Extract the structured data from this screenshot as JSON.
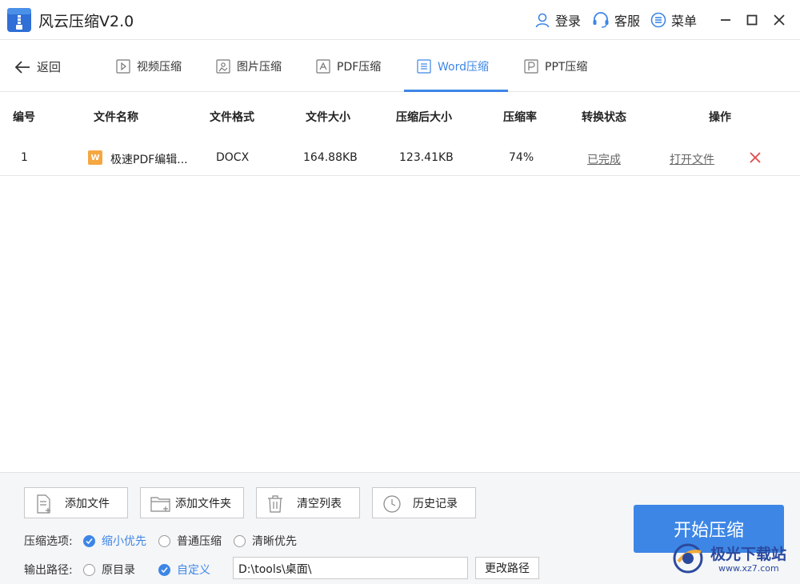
{
  "app": {
    "title": "风云压缩V2.0",
    "accent_color": "#3d86e6"
  },
  "header_actions": {
    "login": "登录",
    "service": "客服",
    "menu": "菜单"
  },
  "nav": {
    "back": "返回",
    "tabs": [
      {
        "label": "视频压缩",
        "icon": "video-icon"
      },
      {
        "label": "图片压缩",
        "icon": "image-icon"
      },
      {
        "label": "PDF压缩",
        "icon": "pdf-icon"
      },
      {
        "label": "Word压缩",
        "icon": "word-doc-icon",
        "active": true
      },
      {
        "label": "PPT压缩",
        "icon": "ppt-icon"
      }
    ]
  },
  "table": {
    "columns": [
      "编号",
      "文件名称",
      "文件格式",
      "文件大小",
      "压缩后大小",
      "压缩率",
      "转换状态",
      "操作"
    ],
    "rows": [
      {
        "index": "1",
        "badge": "W",
        "name": "极速PDF编辑...",
        "format": "DOCX",
        "size": "164.88KB",
        "compressed_size": "123.41KB",
        "ratio": "74%",
        "status": "已完成",
        "action": "打开文件"
      }
    ]
  },
  "bottom": {
    "buttons": {
      "add_file": "添加文件",
      "add_folder": "添加文件夹",
      "clear_list": "清空列表",
      "history": "历史记录"
    },
    "compress_option_label": "压缩选项:",
    "compress_options": [
      "缩小优先",
      "普通压缩",
      "清晰优先"
    ],
    "compress_selected": "缩小优先",
    "output_label": "输出路径:",
    "output_options": [
      "原目录",
      "自定义"
    ],
    "output_selected": "自定义",
    "output_path": "D:\\tools\\桌面\\",
    "change_path": "更改路径",
    "start": "开始压缩"
  },
  "watermark": {
    "text": "极光下载站",
    "url": "www.xz7.com"
  }
}
